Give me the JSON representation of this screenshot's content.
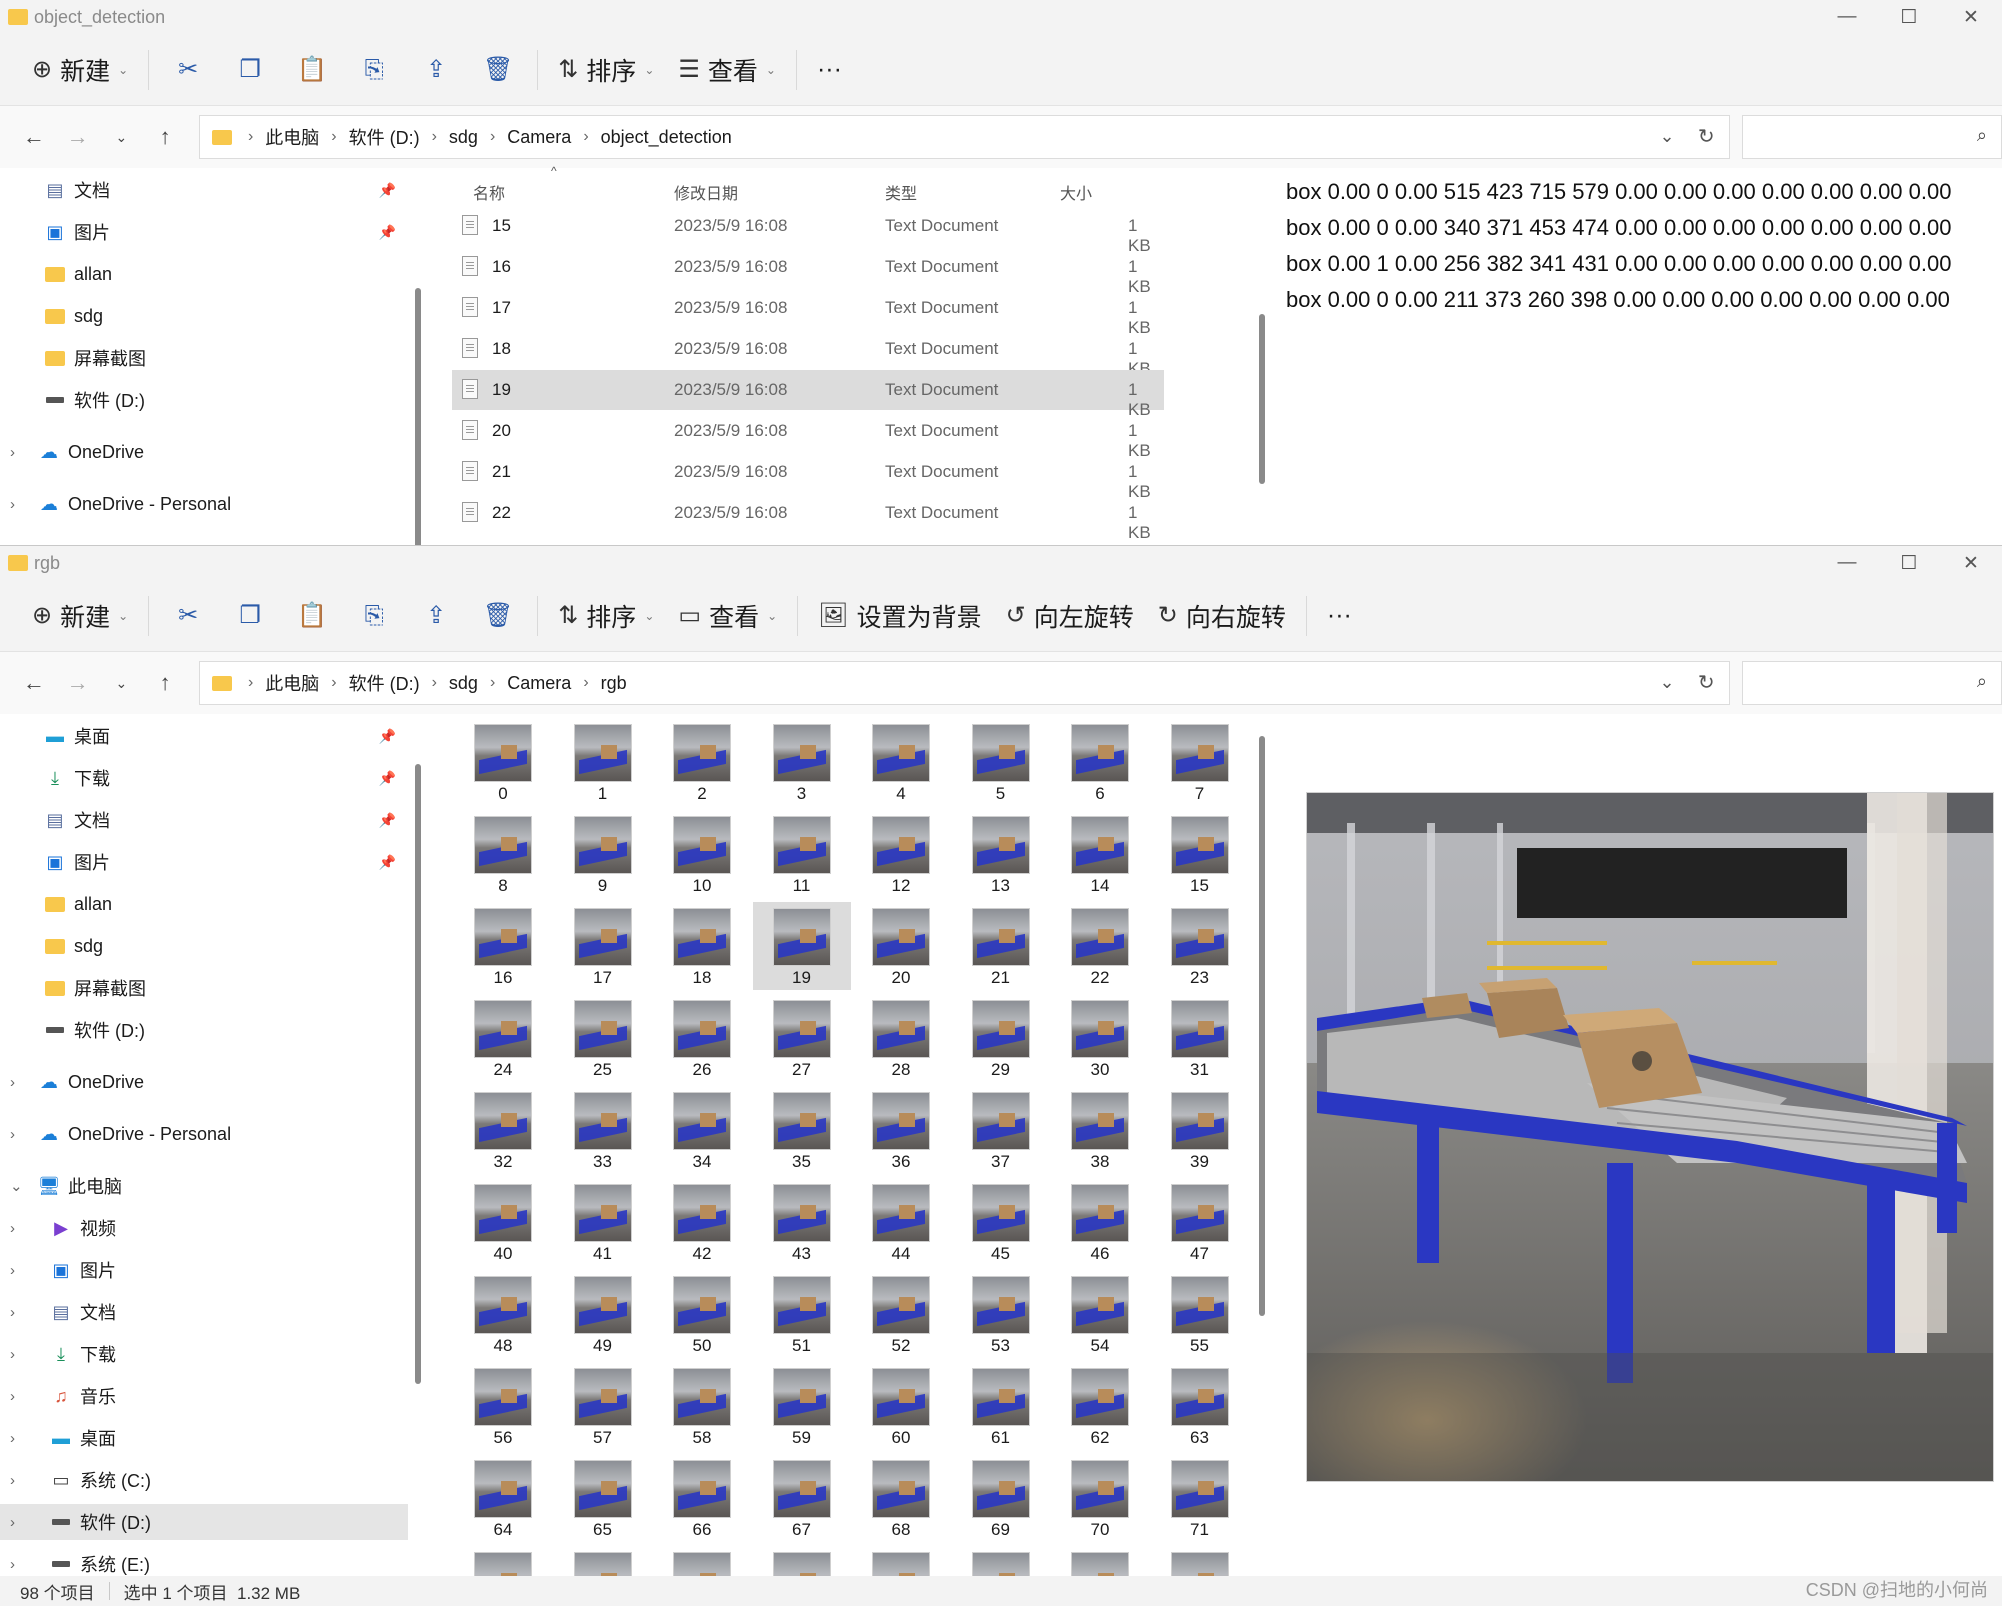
{
  "window1": {
    "title": "object_detection",
    "cmd": {
      "new": "新建",
      "sort": "排序",
      "view": "查看",
      "more": "···"
    },
    "path": [
      "此电脑",
      "软件 (D:)",
      "sdg",
      "Camera",
      "object_detection"
    ],
    "nav": [
      {
        "label": "文档",
        "icon": "document-icon",
        "pinned": true
      },
      {
        "label": "图片",
        "icon": "pictures-icon",
        "pinned": true
      },
      {
        "label": "allan",
        "icon": "folder-icon"
      },
      {
        "label": "sdg",
        "icon": "folder-icon"
      },
      {
        "label": "屏幕截图",
        "icon": "folder-icon"
      },
      {
        "label": "软件 (D:)",
        "icon": "drive-icon"
      },
      {
        "label": "OneDrive",
        "icon": "onedrive-icon",
        "expandable": true
      },
      {
        "label": "OneDrive - Personal",
        "icon": "onedrive-icon",
        "expandable": true
      }
    ],
    "columns": {
      "name": "名称",
      "date": "修改日期",
      "type": "类型",
      "size": "大小"
    },
    "files": [
      {
        "name": "15",
        "date": "2023/5/9 16:08",
        "type": "Text Document",
        "size": "1 KB"
      },
      {
        "name": "16",
        "date": "2023/5/9 16:08",
        "type": "Text Document",
        "size": "1 KB"
      },
      {
        "name": "17",
        "date": "2023/5/9 16:08",
        "type": "Text Document",
        "size": "1 KB"
      },
      {
        "name": "18",
        "date": "2023/5/9 16:08",
        "type": "Text Document",
        "size": "1 KB"
      },
      {
        "name": "19",
        "date": "2023/5/9 16:08",
        "type": "Text Document",
        "size": "1 KB",
        "selected": true
      },
      {
        "name": "20",
        "date": "2023/5/9 16:08",
        "type": "Text Document",
        "size": "1 KB"
      },
      {
        "name": "21",
        "date": "2023/5/9 16:08",
        "type": "Text Document",
        "size": "1 KB"
      },
      {
        "name": "22",
        "date": "2023/5/9 16:08",
        "type": "Text Document",
        "size": "1 KB"
      }
    ],
    "preview_lines": [
      "box 0.00 0 0.00 515 423 715 579 0.00 0.00 0.00 0.00 0.00 0.00 0.00",
      "box 0.00 0 0.00 340 371 453 474 0.00 0.00 0.00 0.00 0.00 0.00 0.00",
      "box 0.00 1 0.00 256 382 341 431 0.00 0.00 0.00 0.00 0.00 0.00 0.00",
      "box 0.00 0 0.00 211 373 260 398 0.00 0.00 0.00 0.00 0.00 0.00 0.00"
    ]
  },
  "window2": {
    "title": "rgb",
    "cmd": {
      "new": "新建",
      "sort": "排序",
      "view": "查看",
      "set_bg": "设置为背景",
      "rotate_left": "向左旋转",
      "rotate_right": "向右旋转",
      "more": "···"
    },
    "path": [
      "此电脑",
      "软件 (D:)",
      "sdg",
      "Camera",
      "rgb"
    ],
    "nav": [
      {
        "label": "桌面",
        "icon": "desktop-icon",
        "pinned": true
      },
      {
        "label": "下载",
        "icon": "download-icon",
        "pinned": true
      },
      {
        "label": "文档",
        "icon": "document-icon",
        "pinned": true
      },
      {
        "label": "图片",
        "icon": "pictures-icon",
        "pinned": true
      },
      {
        "label": "allan",
        "icon": "folder-icon"
      },
      {
        "label": "sdg",
        "icon": "folder-icon"
      },
      {
        "label": "屏幕截图",
        "icon": "folder-icon"
      },
      {
        "label": "软件 (D:)",
        "icon": "drive-icon"
      },
      {
        "label": "OneDrive",
        "icon": "onedrive-icon",
        "expandable": true
      },
      {
        "label": "OneDrive - Personal",
        "icon": "onedrive-icon",
        "expandable": true
      },
      {
        "label": "此电脑",
        "icon": "this-pc-icon",
        "expanded": true
      },
      {
        "label": "视频",
        "icon": "videos-icon",
        "expandable": true
      },
      {
        "label": "图片",
        "icon": "pictures-icon",
        "expandable": true
      },
      {
        "label": "文档",
        "icon": "document-icon",
        "expandable": true
      },
      {
        "label": "下载",
        "icon": "download-icon",
        "expandable": true
      },
      {
        "label": "音乐",
        "icon": "music-icon",
        "expandable": true
      },
      {
        "label": "桌面",
        "icon": "desktop-icon",
        "expandable": true
      },
      {
        "label": "系统 (C:)",
        "icon": "system-drive-icon",
        "expandable": true
      },
      {
        "label": "软件 (D:)",
        "icon": "drive-icon",
        "expandable": true,
        "selected": true
      },
      {
        "label": "系统 (E:)",
        "icon": "drive-icon",
        "expandable": true
      }
    ],
    "thumbnails": [
      "0",
      "1",
      "2",
      "3",
      "4",
      "5",
      "6",
      "7",
      "8",
      "9",
      "10",
      "11",
      "12",
      "13",
      "14",
      "15",
      "16",
      "17",
      "18",
      "19",
      "20",
      "21",
      "22",
      "23",
      "24",
      "25",
      "26",
      "27",
      "28",
      "29",
      "30",
      "31",
      "32",
      "33",
      "34",
      "35",
      "36",
      "37",
      "38",
      "39",
      "40",
      "41",
      "42",
      "43",
      "44",
      "45",
      "46",
      "47",
      "48",
      "49",
      "50",
      "51",
      "52",
      "53",
      "54",
      "55",
      "56",
      "57",
      "58",
      "59",
      "60",
      "61",
      "62",
      "63",
      "64",
      "65",
      "66",
      "67",
      "68",
      "69",
      "70",
      "71"
    ],
    "selected_thumbnail": "19",
    "status": {
      "count": "98 个项目",
      "selection": "选中 1 个项目  1.32 MB"
    }
  },
  "watermark": "CSDN @扫地的小何尚",
  "colors": {
    "accent": "#2a5aa8",
    "folder": "#f8c84c",
    "conveyor": "#2a37c2",
    "selection": "#dcdcdc"
  }
}
